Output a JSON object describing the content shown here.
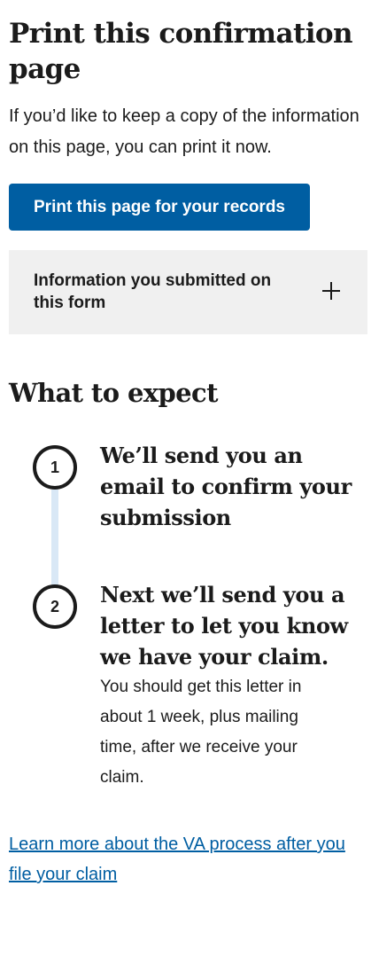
{
  "print_section": {
    "title": "Print this confirmation page",
    "intro": "If you’d like to keep a copy of the information on this page, you can print it now.",
    "print_button_label": "Print this page for your records"
  },
  "accordion": {
    "title": "Information you submitted on this form",
    "expand_icon": "plus-icon",
    "expanded": false
  },
  "what_to_expect": {
    "title": "What to expect",
    "steps": [
      {
        "number": "1",
        "heading": "We’ll send you an email to confirm your submission",
        "body": ""
      },
      {
        "number": "2",
        "heading": "Next we’ll send you a letter to let you know we have your claim.",
        "body": "You should get this letter in about 1 week, plus mailing time, after we receive your claim."
      }
    ]
  },
  "learn_more_link": "Learn more about the VA process after you file your claim",
  "colors": {
    "primary": "#005ea2",
    "accordion_bg": "#f0f0f0",
    "connector": "#d9e8f6",
    "text": "#1b1b1b"
  }
}
